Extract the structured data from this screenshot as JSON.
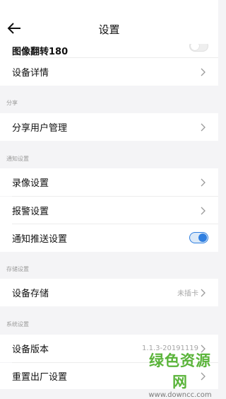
{
  "header": {
    "title": "设置"
  },
  "rows": {
    "image_flip": {
      "label": "图像翻转180",
      "toggle_on": false
    },
    "device_details": {
      "label": "设备详情"
    },
    "share_users": {
      "label": "分享用户管理"
    },
    "recording": {
      "label": "录像设置"
    },
    "alarm": {
      "label": "报警设置"
    },
    "push": {
      "label": "通知推送设置",
      "toggle_on": true
    },
    "storage": {
      "label": "设备存储",
      "value": "未插卡"
    },
    "version": {
      "label": "设备版本",
      "value": "1.1.3-20191119"
    },
    "factory_reset": {
      "label": "重置出厂设置"
    }
  },
  "sections": {
    "share": "分享",
    "notify": "通知设置",
    "storage": "存储设置",
    "system": "系统设置"
  },
  "watermark": {
    "main": "绿色资源网",
    "sub": "www.downcc.com"
  },
  "colors": {
    "accent": "#2f7fe0",
    "background": "#f4f4f6",
    "watermark": "#5ab43a"
  },
  "icons": {
    "back": "arrow-left-icon",
    "chevron": "chevron-right-icon"
  }
}
